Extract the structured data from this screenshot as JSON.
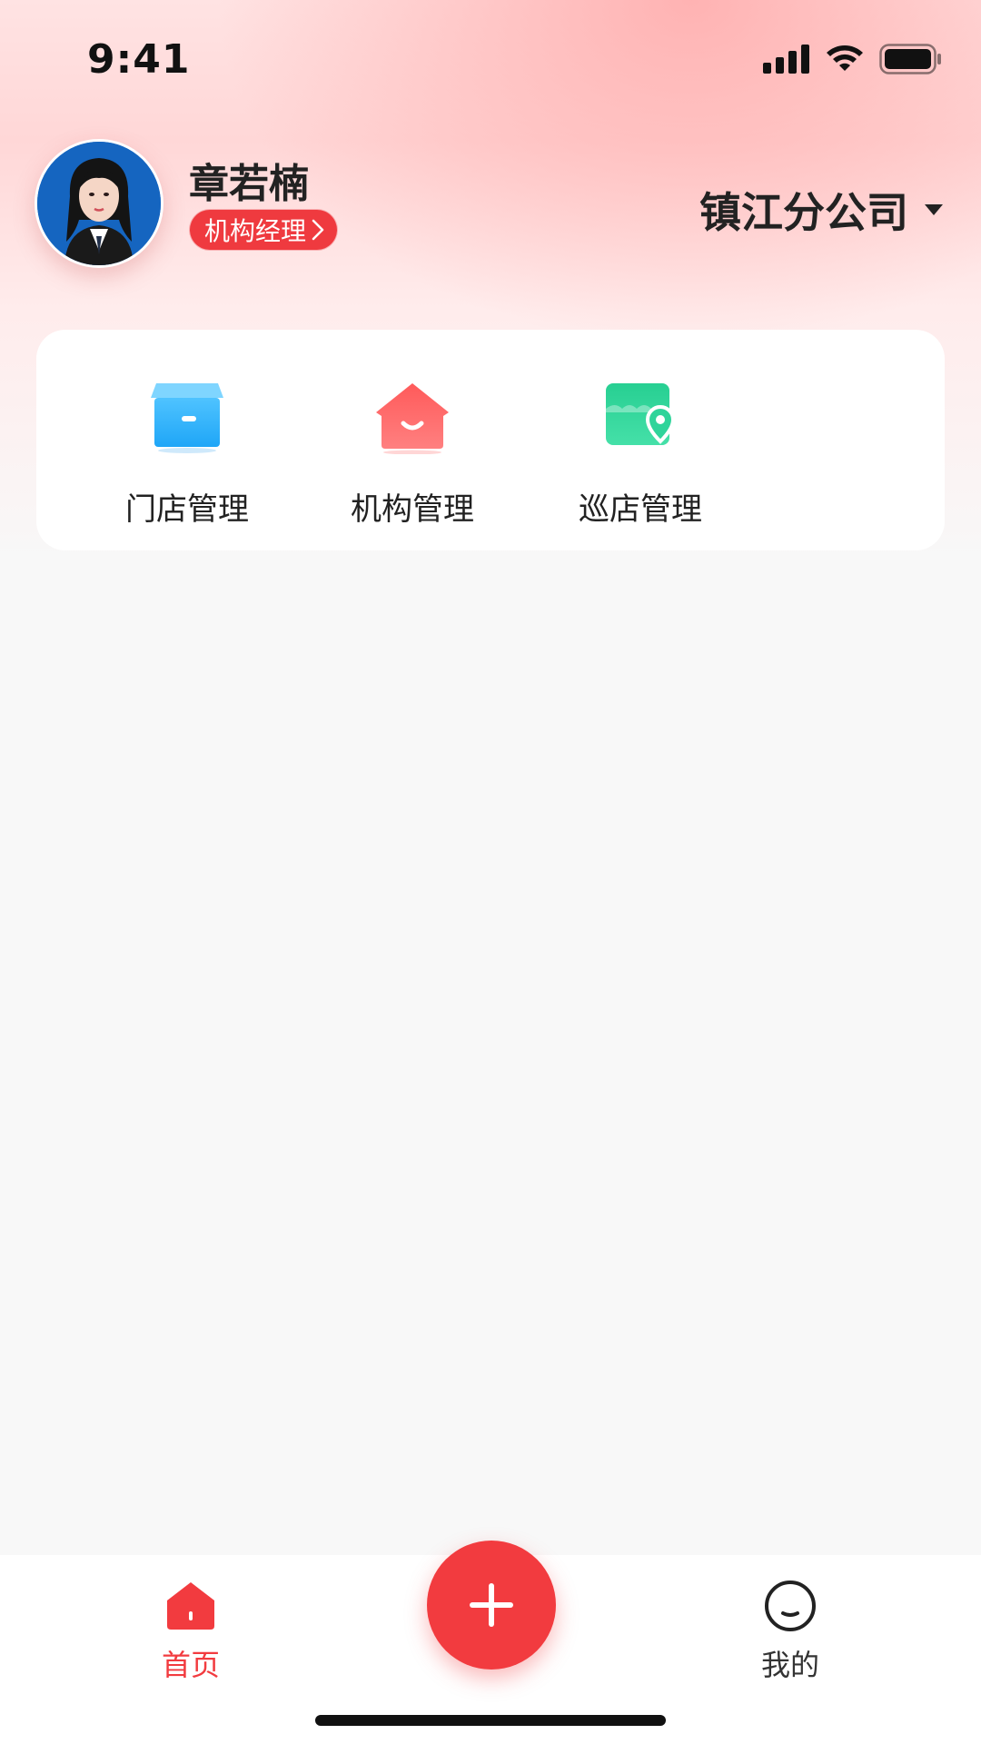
{
  "status_bar": {
    "time": "9:41"
  },
  "header": {
    "user_name": "章若楠",
    "role": "机构经理",
    "branch": "镇江分公司"
  },
  "functions": [
    {
      "label": "门店管理",
      "icon": "store-box-icon",
      "color": "#29aefc"
    },
    {
      "label": "机构管理",
      "icon": "org-house-icon",
      "color": "#ff6b6b"
    },
    {
      "label": "巡店管理",
      "icon": "store-location-icon",
      "color": "#2fd49a"
    }
  ],
  "bottom_nav": {
    "home_label": "首页",
    "mine_label": "我的",
    "active_color": "#f23b3f",
    "inactive_color": "#333333"
  },
  "colors": {
    "accent": "#f23b3f"
  }
}
